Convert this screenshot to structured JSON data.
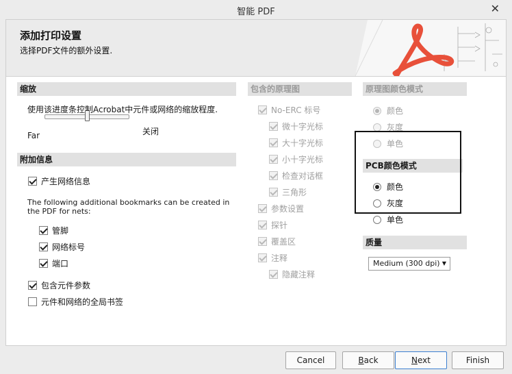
{
  "window": {
    "title": "智能 PDF",
    "close_glyph": "✕"
  },
  "header": {
    "title": "添加打印设置",
    "subtitle": "选择PDF文件的额外设置."
  },
  "zoom": {
    "section": "缩放",
    "description": "使用该进度条控制Acrobat中元件或网络的缩放程度.",
    "far_label": "Far",
    "near_label": "关闭",
    "slider_value": 0.5
  },
  "additional": {
    "section": "附加信息",
    "generate_net_info": "产生网络信息",
    "bookmarks_note_line1": "The following additional bookmarks can be created in",
    "bookmarks_note_line2": "the PDF for nets:",
    "pins": "管脚",
    "net_labels": "网络标号",
    "ports": "端口",
    "include_component_params": "包含元件参数",
    "global_bookmarks": "元件和网络的全局书签"
  },
  "schematics": {
    "section": "包含的原理图",
    "no_erc": "No-ERC 标号",
    "thin_cross": "微十字光标",
    "large_cross": "大十字光标",
    "small_cross": "小十字光标",
    "check_dialog": "检查对话框",
    "triangle": "三角形",
    "param_settings": "参数设置",
    "probes": "探针",
    "blankets": "覆盖区",
    "notes": "注释",
    "hidden_notes": "隐藏注释"
  },
  "sch_color": {
    "section": "原理图颜色模式",
    "color": "颜色",
    "gray": "灰度",
    "mono": "单色"
  },
  "pcb_color": {
    "section": "PCB颜色模式",
    "color": "颜色",
    "gray": "灰度",
    "mono": "单色"
  },
  "quality": {
    "section": "质量",
    "selected": "Medium (300 dpi)",
    "arrow": "▼"
  },
  "buttons": {
    "cancel": "Cancel",
    "back_first": "B",
    "back_rest": "ack",
    "next_first": "N",
    "next_rest": "ext",
    "finish": "Finish"
  },
  "colors": {
    "acrobat_red": "#e8503a",
    "section_bg": "#e1e1e1",
    "primary_border": "#3c7fd0"
  }
}
